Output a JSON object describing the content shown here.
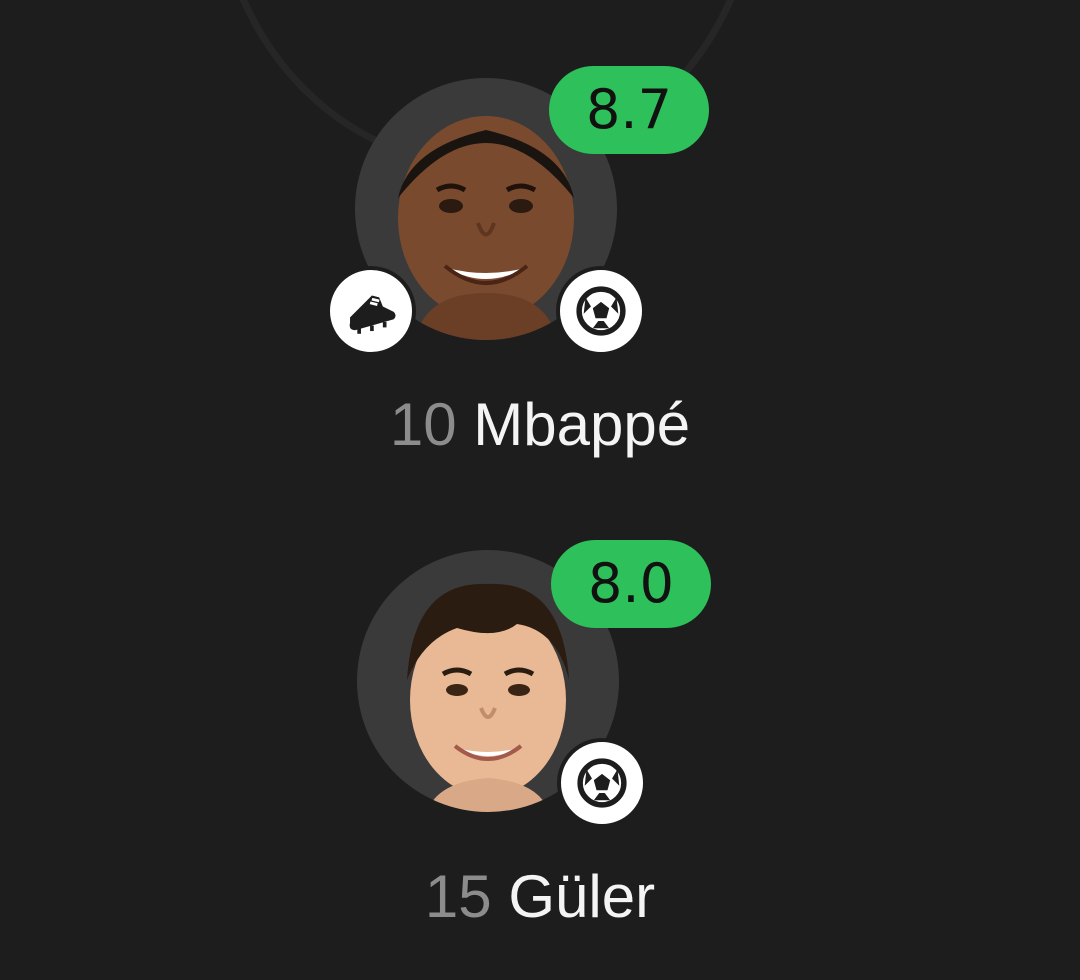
{
  "lineup": {
    "players": [
      {
        "number": "10",
        "name": "Mbappé",
        "rating": "8.7",
        "events": [
          "boot-icon",
          "soccer-ball-icon"
        ]
      },
      {
        "number": "15",
        "name": "Güler",
        "rating": "8.0",
        "events": [
          "soccer-ball-icon"
        ]
      }
    ]
  },
  "colors": {
    "background": "#1d1d1d",
    "rating_badge": "#2ec05a",
    "avatar_bg": "#3a3a3a",
    "shirt_number": "#8c8c8c",
    "player_name": "#f4f4f4"
  }
}
